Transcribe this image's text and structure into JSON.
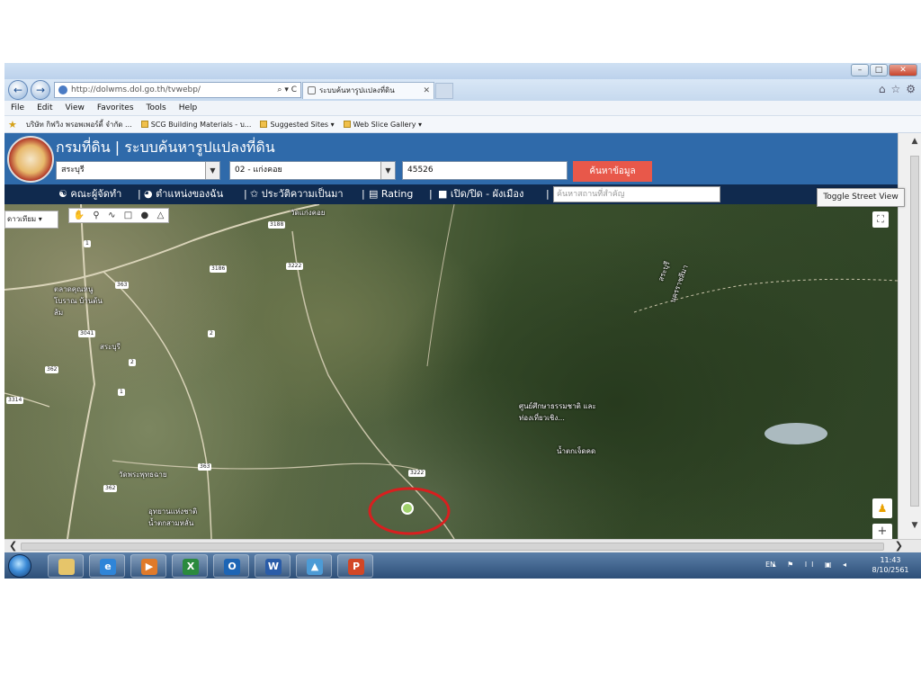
{
  "browser": {
    "address": "http://dolwms.dol.go.th/tvwebp/",
    "address_controls": "⌕ ▾ C",
    "tab_title": "ระบบค้นหารูปแปลงที่ดิน",
    "menu": [
      "File",
      "Edit",
      "View",
      "Favorites",
      "Tools",
      "Help"
    ],
    "favorites": [
      "บริษัท กิฟวิง พรอพเพอร์ตี้ จำกัด ...",
      "SCG Building Materials - บ...",
      "Suggested Sites ▾",
      "Web Slice Gallery ▾"
    ]
  },
  "header": {
    "title": "กรมที่ดิน | ระบบค้นหารูปแปลงที่ดิน",
    "province": "สระบุรี",
    "district": "02 - แก่งคอย",
    "parcel_no": "45526",
    "search_button": "ค้นหาข้อมูล"
  },
  "toolbar": {
    "committee": "คณะผู้จัดทำ",
    "my_location": "ตำแหน่งของฉัน",
    "history": "ประวัติความเป็นมา",
    "rating": "Rating",
    "toggle_plan": "เปิด/ปิด - ผังเมือง",
    "place_placeholder": "ค้นหาสถานที่สำคัญ"
  },
  "map": {
    "map_type": "ดาวเทียม",
    "street_view_button": "Toggle Street View",
    "labels": {
      "kaeng_khoi": "วัดแก่งคอย",
      "market": "ตลาดคุณหนูโบราณ บ้านต้นส้ม",
      "saraburi": "สระบุรี",
      "wildlife_center": "ศูนย์ศึกษาธรรมชาติ และท่องเที่ยวเชิง...",
      "waterfall": "น้ำตกเจ็ดคด",
      "temple": "วัดพระพุทธฉาย",
      "national_park": "อุทยานแห่งชาติ น้ำตกสามหลั่น",
      "border_a": "สระบุรี",
      "border_b": "นครราชสีมา"
    },
    "roads": [
      "3188",
      "3222",
      "3186",
      "363",
      "3041",
      "362",
      "3314",
      "2",
      "3222",
      "362",
      "1",
      "363",
      "1",
      "2"
    ]
  },
  "taskbar": {
    "language": "EN",
    "tray_icons": "▴ ⚑ ll ▣ ◂",
    "time": "11:43",
    "date": "8/10/2561"
  },
  "colors": {
    "header_bg": "#2f6aaa",
    "toolbar_bg": "#102a4e",
    "search_button": "#e8584a",
    "marker_circle": "#d81f1f"
  }
}
